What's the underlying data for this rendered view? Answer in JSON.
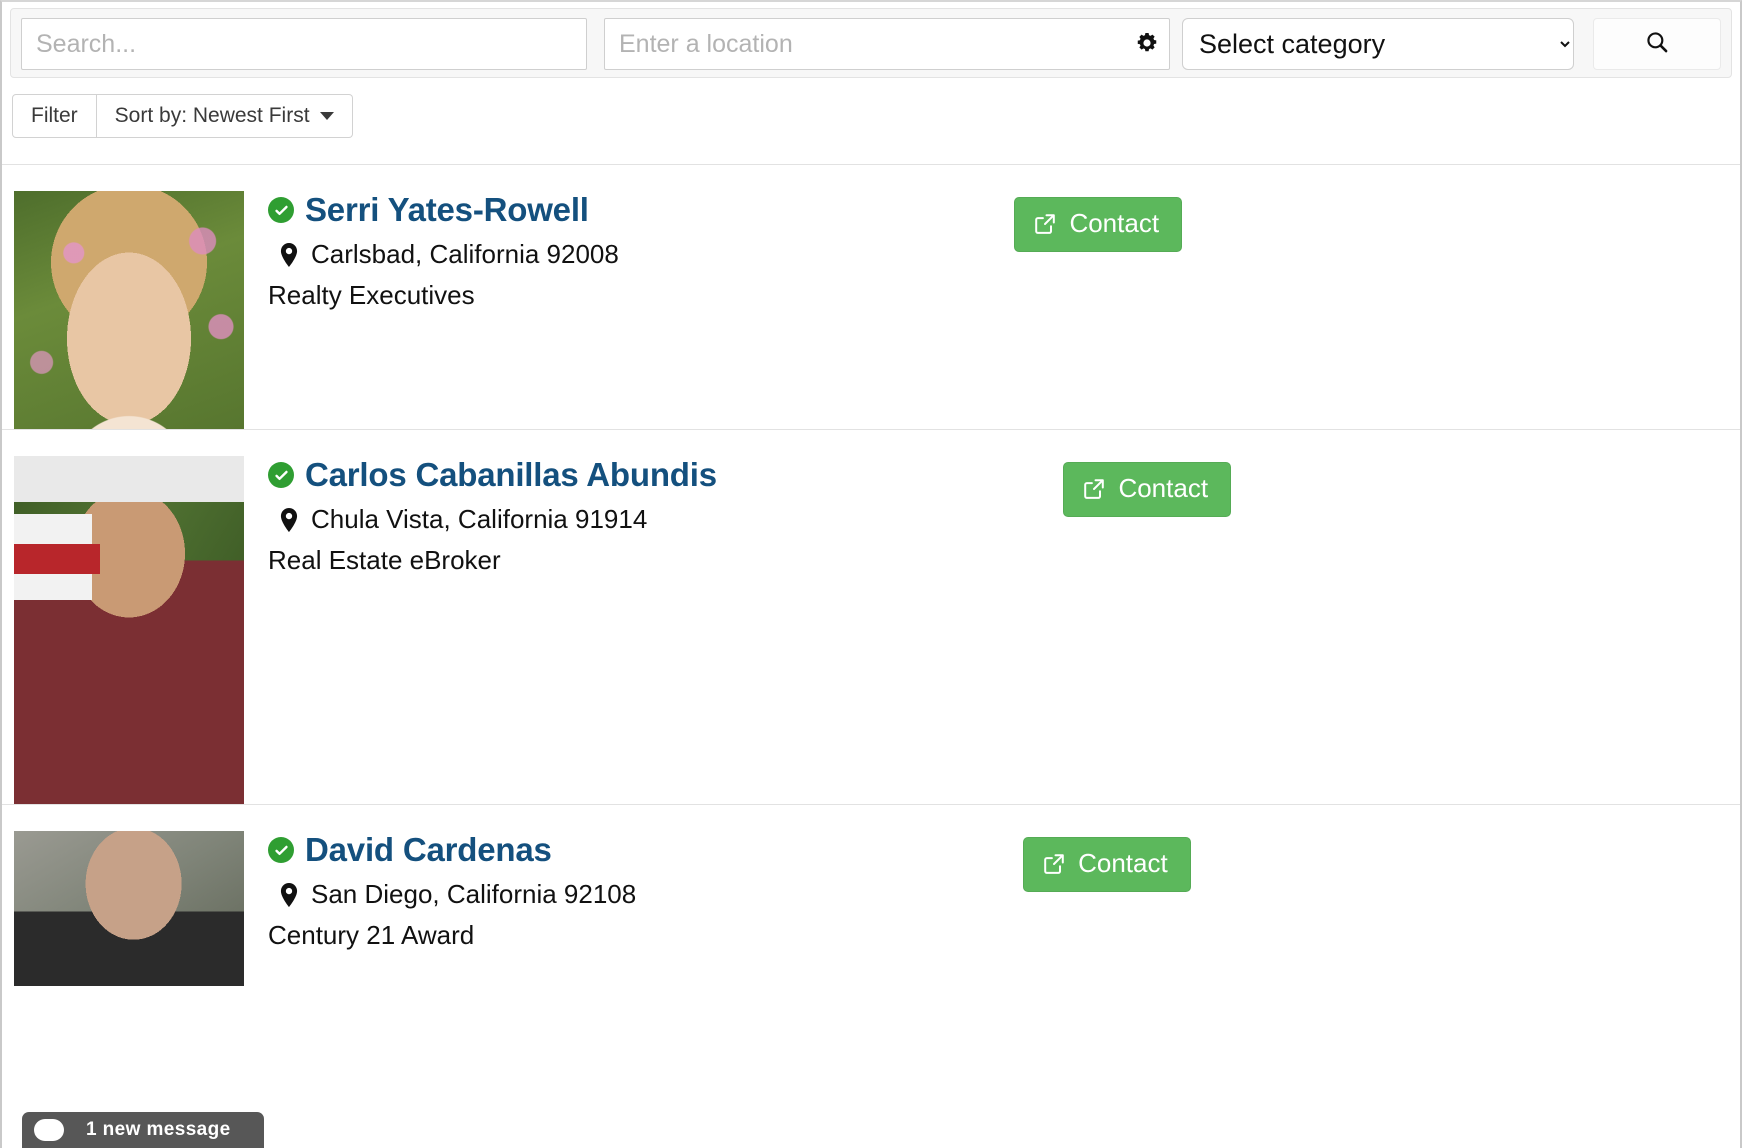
{
  "search": {
    "keyword_placeholder": "Search...",
    "keyword_value": "",
    "location_placeholder": "Enter a location",
    "location_value": "",
    "gear_icon": "gear-icon",
    "category_selected": "Select category",
    "category_options": [
      "Select category"
    ],
    "search_icon": "search-icon"
  },
  "filters": {
    "filter_label": "Filter",
    "sort_label": "Sort by: Newest First",
    "caret_icon": "chevron-down-icon"
  },
  "listings": [
    {
      "verified_icon": "check-circle-icon",
      "name": "Serri Yates-Rowell",
      "location_icon": "map-pin-icon",
      "location": "Carlsbad, California 92008",
      "company": "Realty Executives",
      "contact_label": "Contact",
      "contact_icon": "external-link-icon",
      "photo_class": "ph-a"
    },
    {
      "verified_icon": "check-circle-icon",
      "name": "Carlos Cabanillas Abundis",
      "location_icon": "map-pin-icon",
      "location": "Chula Vista, California 91914",
      "company": "Real Estate eBroker",
      "contact_label": "Contact",
      "contact_icon": "external-link-icon",
      "photo_class": "ph-b"
    },
    {
      "verified_icon": "check-circle-icon",
      "name": "David Cardenas",
      "location_icon": "map-pin-icon",
      "location": "San Diego, California 92108",
      "company": "Century 21 Award",
      "contact_label": "Contact",
      "contact_icon": "external-link-icon",
      "photo_class": "ph-c"
    }
  ],
  "chat": {
    "icon": "chat-bubble-icon",
    "text": "1 new message"
  },
  "colors": {
    "accent_green": "#5cb85c",
    "verified_green": "#2f9e32",
    "name_blue": "#14507e",
    "chat_bar": "#575757"
  }
}
